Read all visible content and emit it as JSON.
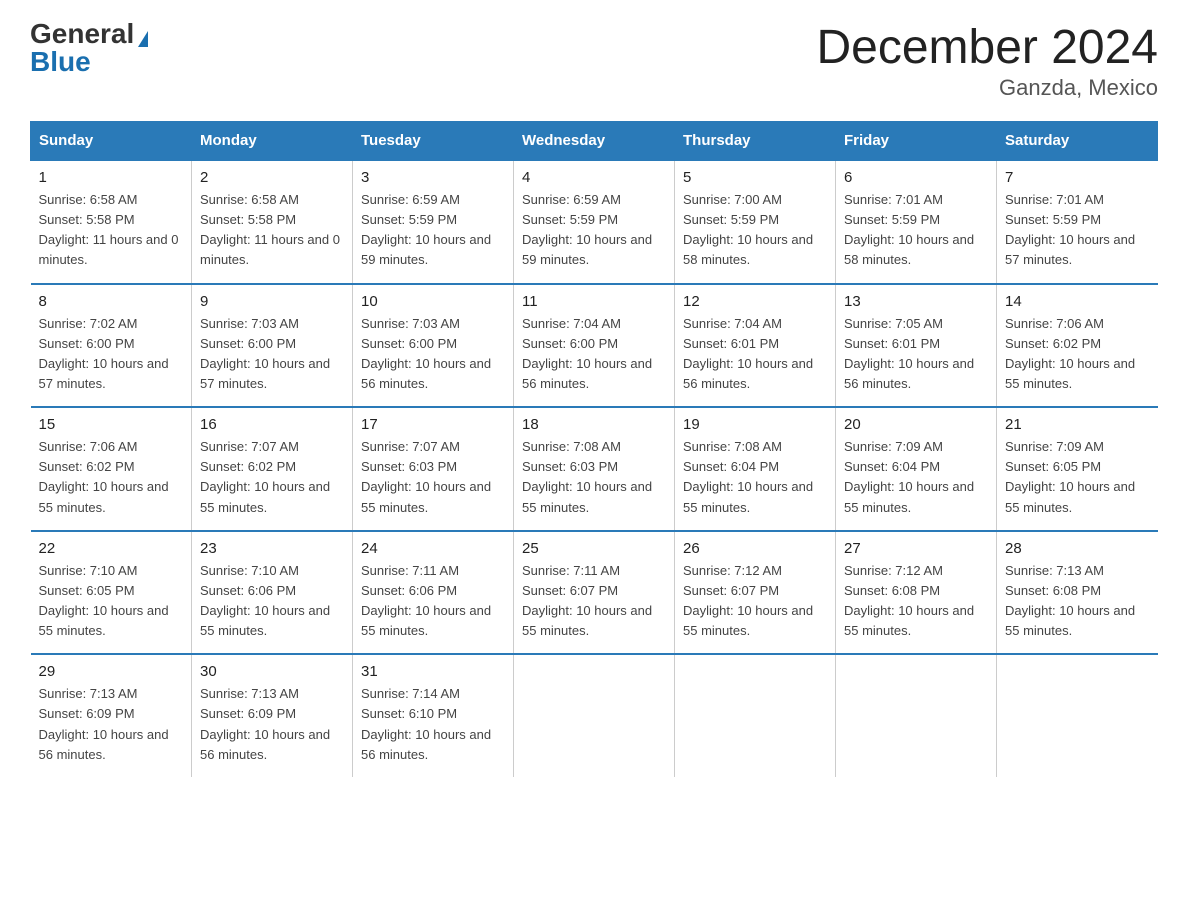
{
  "header": {
    "logo_general": "General",
    "logo_blue": "Blue",
    "month_title": "December 2024",
    "location": "Ganzda, Mexico"
  },
  "days_of_week": [
    "Sunday",
    "Monday",
    "Tuesday",
    "Wednesday",
    "Thursday",
    "Friday",
    "Saturday"
  ],
  "weeks": [
    [
      {
        "day": "1",
        "sunrise": "6:58 AM",
        "sunset": "5:58 PM",
        "daylight": "11 hours and 0 minutes."
      },
      {
        "day": "2",
        "sunrise": "6:58 AM",
        "sunset": "5:58 PM",
        "daylight": "11 hours and 0 minutes."
      },
      {
        "day": "3",
        "sunrise": "6:59 AM",
        "sunset": "5:59 PM",
        "daylight": "10 hours and 59 minutes."
      },
      {
        "day": "4",
        "sunrise": "6:59 AM",
        "sunset": "5:59 PM",
        "daylight": "10 hours and 59 minutes."
      },
      {
        "day": "5",
        "sunrise": "7:00 AM",
        "sunset": "5:59 PM",
        "daylight": "10 hours and 58 minutes."
      },
      {
        "day": "6",
        "sunrise": "7:01 AM",
        "sunset": "5:59 PM",
        "daylight": "10 hours and 58 minutes."
      },
      {
        "day": "7",
        "sunrise": "7:01 AM",
        "sunset": "5:59 PM",
        "daylight": "10 hours and 57 minutes."
      }
    ],
    [
      {
        "day": "8",
        "sunrise": "7:02 AM",
        "sunset": "6:00 PM",
        "daylight": "10 hours and 57 minutes."
      },
      {
        "day": "9",
        "sunrise": "7:03 AM",
        "sunset": "6:00 PM",
        "daylight": "10 hours and 57 minutes."
      },
      {
        "day": "10",
        "sunrise": "7:03 AM",
        "sunset": "6:00 PM",
        "daylight": "10 hours and 56 minutes."
      },
      {
        "day": "11",
        "sunrise": "7:04 AM",
        "sunset": "6:00 PM",
        "daylight": "10 hours and 56 minutes."
      },
      {
        "day": "12",
        "sunrise": "7:04 AM",
        "sunset": "6:01 PM",
        "daylight": "10 hours and 56 minutes."
      },
      {
        "day": "13",
        "sunrise": "7:05 AM",
        "sunset": "6:01 PM",
        "daylight": "10 hours and 56 minutes."
      },
      {
        "day": "14",
        "sunrise": "7:06 AM",
        "sunset": "6:02 PM",
        "daylight": "10 hours and 55 minutes."
      }
    ],
    [
      {
        "day": "15",
        "sunrise": "7:06 AM",
        "sunset": "6:02 PM",
        "daylight": "10 hours and 55 minutes."
      },
      {
        "day": "16",
        "sunrise": "7:07 AM",
        "sunset": "6:02 PM",
        "daylight": "10 hours and 55 minutes."
      },
      {
        "day": "17",
        "sunrise": "7:07 AM",
        "sunset": "6:03 PM",
        "daylight": "10 hours and 55 minutes."
      },
      {
        "day": "18",
        "sunrise": "7:08 AM",
        "sunset": "6:03 PM",
        "daylight": "10 hours and 55 minutes."
      },
      {
        "day": "19",
        "sunrise": "7:08 AM",
        "sunset": "6:04 PM",
        "daylight": "10 hours and 55 minutes."
      },
      {
        "day": "20",
        "sunrise": "7:09 AM",
        "sunset": "6:04 PM",
        "daylight": "10 hours and 55 minutes."
      },
      {
        "day": "21",
        "sunrise": "7:09 AM",
        "sunset": "6:05 PM",
        "daylight": "10 hours and 55 minutes."
      }
    ],
    [
      {
        "day": "22",
        "sunrise": "7:10 AM",
        "sunset": "6:05 PM",
        "daylight": "10 hours and 55 minutes."
      },
      {
        "day": "23",
        "sunrise": "7:10 AM",
        "sunset": "6:06 PM",
        "daylight": "10 hours and 55 minutes."
      },
      {
        "day": "24",
        "sunrise": "7:11 AM",
        "sunset": "6:06 PM",
        "daylight": "10 hours and 55 minutes."
      },
      {
        "day": "25",
        "sunrise": "7:11 AM",
        "sunset": "6:07 PM",
        "daylight": "10 hours and 55 minutes."
      },
      {
        "day": "26",
        "sunrise": "7:12 AM",
        "sunset": "6:07 PM",
        "daylight": "10 hours and 55 minutes."
      },
      {
        "day": "27",
        "sunrise": "7:12 AM",
        "sunset": "6:08 PM",
        "daylight": "10 hours and 55 minutes."
      },
      {
        "day": "28",
        "sunrise": "7:13 AM",
        "sunset": "6:08 PM",
        "daylight": "10 hours and 55 minutes."
      }
    ],
    [
      {
        "day": "29",
        "sunrise": "7:13 AM",
        "sunset": "6:09 PM",
        "daylight": "10 hours and 56 minutes."
      },
      {
        "day": "30",
        "sunrise": "7:13 AM",
        "sunset": "6:09 PM",
        "daylight": "10 hours and 56 minutes."
      },
      {
        "day": "31",
        "sunrise": "7:14 AM",
        "sunset": "6:10 PM",
        "daylight": "10 hours and 56 minutes."
      },
      null,
      null,
      null,
      null
    ]
  ]
}
